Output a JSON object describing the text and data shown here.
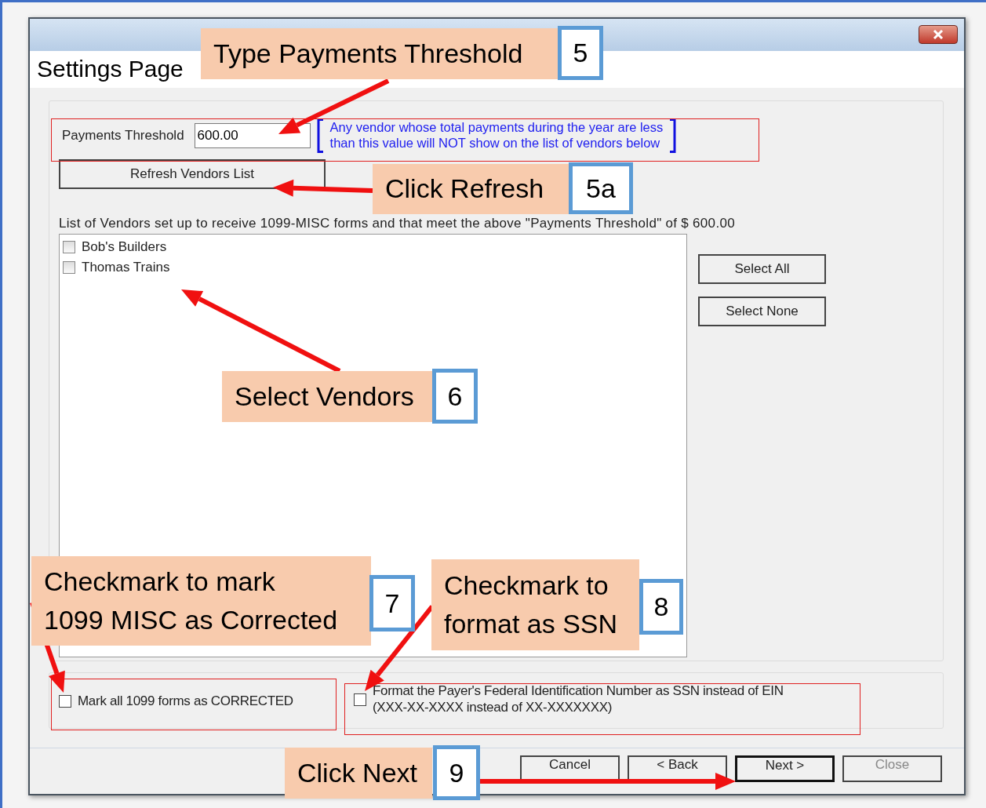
{
  "dialog": {
    "title": "Settings Page",
    "payments_threshold": {
      "label": "Payments Threshold",
      "value": "600.00",
      "note": "Any vendor whose total payments during the year are less\nthan this value will NOT show on the list of vendors below"
    },
    "refresh_button": "Refresh Vendors List",
    "list_caption": "List of Vendors set up to receive 1099-MISC forms and that meet the above \"Payments Threshold\" of $  600.00",
    "vendors": [
      {
        "name": "Bob's Builders",
        "checked": false
      },
      {
        "name": "Thomas Trains",
        "checked": false
      }
    ],
    "side_buttons": [
      "Select All",
      "Select None"
    ],
    "options": [
      {
        "label": "Mark all 1099 forms as CORRECTED",
        "checked": false
      },
      {
        "label": "Format the Payer's Federal Identification Number as SSN instead of EIN\n(XXX-XX-XXXX instead of XX-XXXXXXX)",
        "checked": false
      }
    ],
    "buttons": [
      {
        "label": "Cancel",
        "default": false,
        "disabled": false
      },
      {
        "label": "< Back",
        "default": false,
        "disabled": false
      },
      {
        "label": "Next >",
        "default": true,
        "disabled": false
      },
      {
        "label": "Close",
        "default": false,
        "disabled": true
      }
    ]
  },
  "annotations": [
    {
      "text": "Type Payments Threshold",
      "step": "5"
    },
    {
      "text": "Click Refresh",
      "step": "5a"
    },
    {
      "text": "Select Vendors",
      "step": "6"
    },
    {
      "text": "Checkmark to mark\n1099 MISC as Corrected",
      "step": "7"
    },
    {
      "text": "Checkmark to\nformat as SSN",
      "step": "8"
    },
    {
      "text": "Click Next",
      "step": "9"
    }
  ]
}
